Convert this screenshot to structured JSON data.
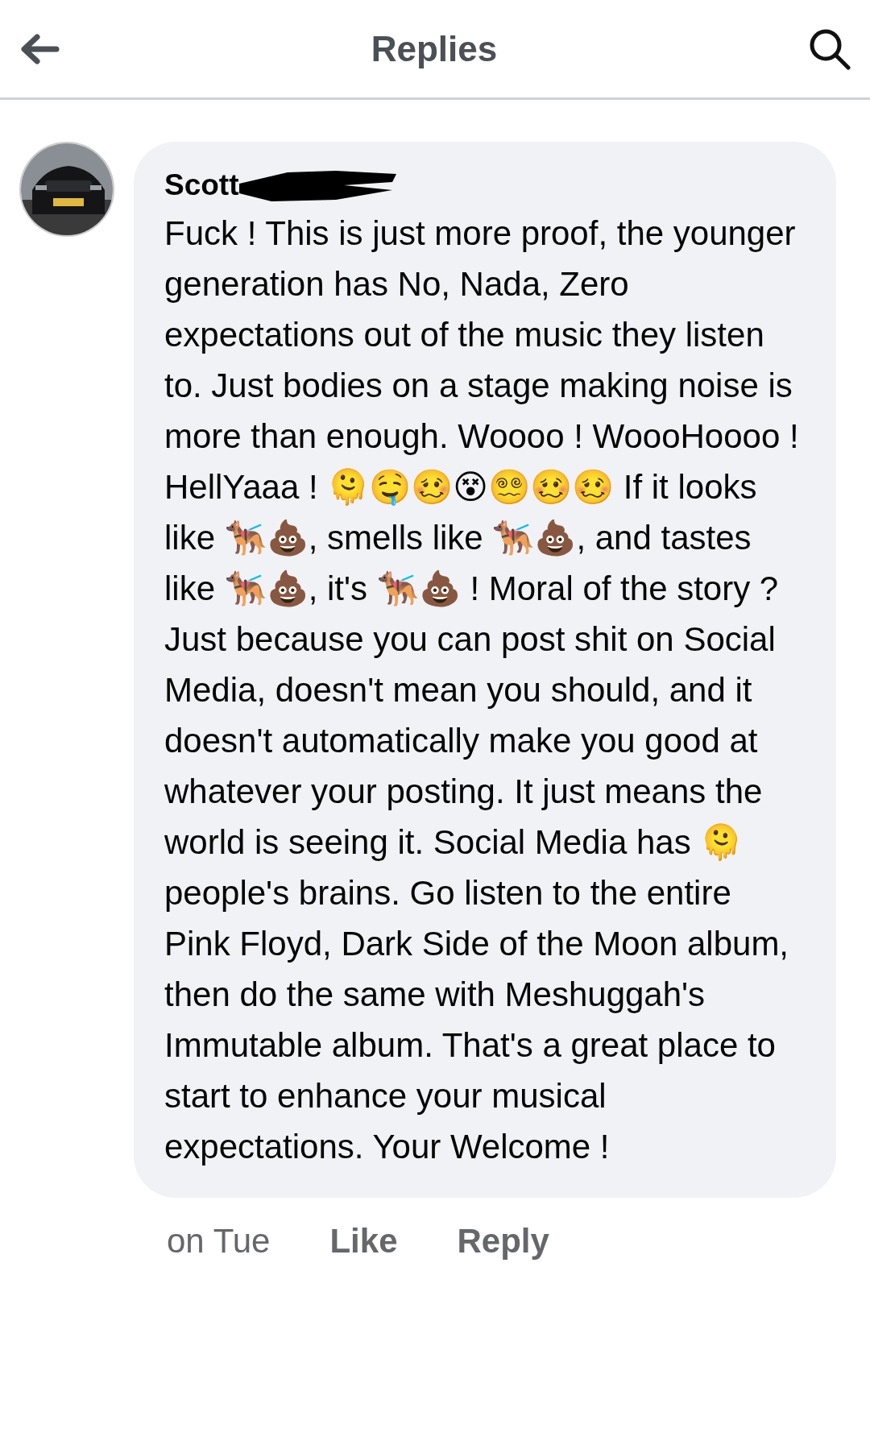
{
  "header": {
    "title": "Replies"
  },
  "comment": {
    "author": "Scott",
    "text": "Fuck ! This is just more proof, the younger generation has No, Nada, Zero expectations out of the music they listen to. Just bodies on a stage making noise is more than enough. Woooo ! WoooHoooo ! HellYaaa ! 🫠🤤🥴😵😵‍💫🥴🥴 If it looks like 🐕‍🦺💩, smells like 🐕‍🦺💩, and tastes like 🐕‍🦺💩, it's 🐕‍🦺💩 ! Moral of the story ? Just because you can post shit on Social Media, doesn't mean you should, and it doesn't automatically make you good at whatever your posting. It just means the world is seeing it. Social Media has 🫠 people's brains. Go listen to the entire Pink Floyd, Dark Side of the Moon album, then do the same with Meshuggah's Immutable album. That's a great place to start to enhance your musical expectations. Your Welcome !"
  },
  "actions": {
    "time": "on Tue",
    "buttons": [
      "Like",
      "Reply"
    ]
  }
}
